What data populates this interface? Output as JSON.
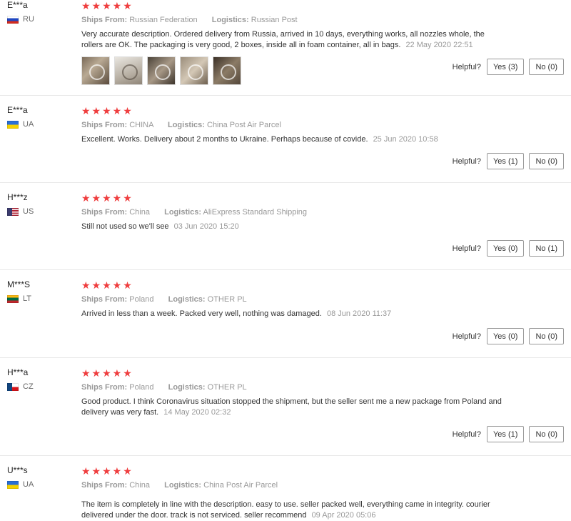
{
  "labels": {
    "ships_from": "Ships From:",
    "logistics": "Logistics:",
    "helpful": "Helpful?"
  },
  "reviews": [
    {
      "name": "E***a",
      "country": "RU",
      "flag": [
        "#ffffff",
        "#1f47c2",
        "#d52b1e"
      ],
      "stars": "★★★★★",
      "ships_from": "Russian Federation",
      "logistics": "Russian Post",
      "text": "Very accurate description. Ordered delivery from Russia, arrived in 10 days, everything works, all nozzles whole, the rollers are OK. The packaging is very good, 2 boxes, inside all in foam container, all in bags.",
      "date": "22 May 2020 22:51",
      "yes": "Yes (3)",
      "no": "No (0)",
      "photos": 5
    },
    {
      "name": "E***a",
      "country": "UA",
      "flag": [
        "#2a6fd6",
        "#f5d200"
      ],
      "stars": "★★★★★",
      "ships_from": "CHINA",
      "logistics": "China Post Air Parcel",
      "text": "Excellent. Works. Delivery about 2 months to Ukraine. Perhaps because of covide.",
      "date": "25 Jun 2020 10:58",
      "yes": "Yes (1)",
      "no": "No (0)"
    },
    {
      "name": "H***z",
      "country": "US",
      "flag": [
        "#b22234",
        "#ffffff",
        "#3c3b6e"
      ],
      "stars": "★★★★★",
      "ships_from": "China",
      "logistics": "AliExpress Standard Shipping",
      "text": "Still not used so we'll see",
      "date": "03 Jun 2020 15:20",
      "yes": "Yes (0)",
      "no": "No (1)"
    },
    {
      "name": "M***S",
      "country": "LT",
      "flag": [
        "#fdb913",
        "#006a44",
        "#c1272d"
      ],
      "stars": "★★★★★",
      "ships_from": "Poland",
      "logistics": "OTHER PL",
      "text": "Arrived in less than a week. Packed very well, nothing was damaged.",
      "date": "08 Jun 2020 11:37",
      "yes": "Yes (0)",
      "no": "No (0)"
    },
    {
      "name": "H***a",
      "country": "CZ",
      "flag": [
        "#ffffff",
        "#d7141a",
        "#11457e"
      ],
      "stars": "★★★★★",
      "ships_from": "Poland",
      "logistics": "OTHER PL",
      "text": "Good product. I think Coronavirus situation stopped the shipment, but the seller sent me a new package from Poland and delivery was very fast.",
      "date": "14 May 2020 02:32",
      "yes": "Yes (1)",
      "no": "No (0)"
    },
    {
      "name": "U***s",
      "country": "UA",
      "flag": [
        "#2a6fd6",
        "#f5d200"
      ],
      "stars": "★★★★★",
      "ships_from": "China",
      "logistics": "China Post Air Parcel",
      "text": "The item is completely in line with the description. easy to use. seller packed well, everything came in integrity. courier delivered under the door. track is not serviced. seller recommend",
      "date": "09 Apr 2020 05:06"
    }
  ]
}
